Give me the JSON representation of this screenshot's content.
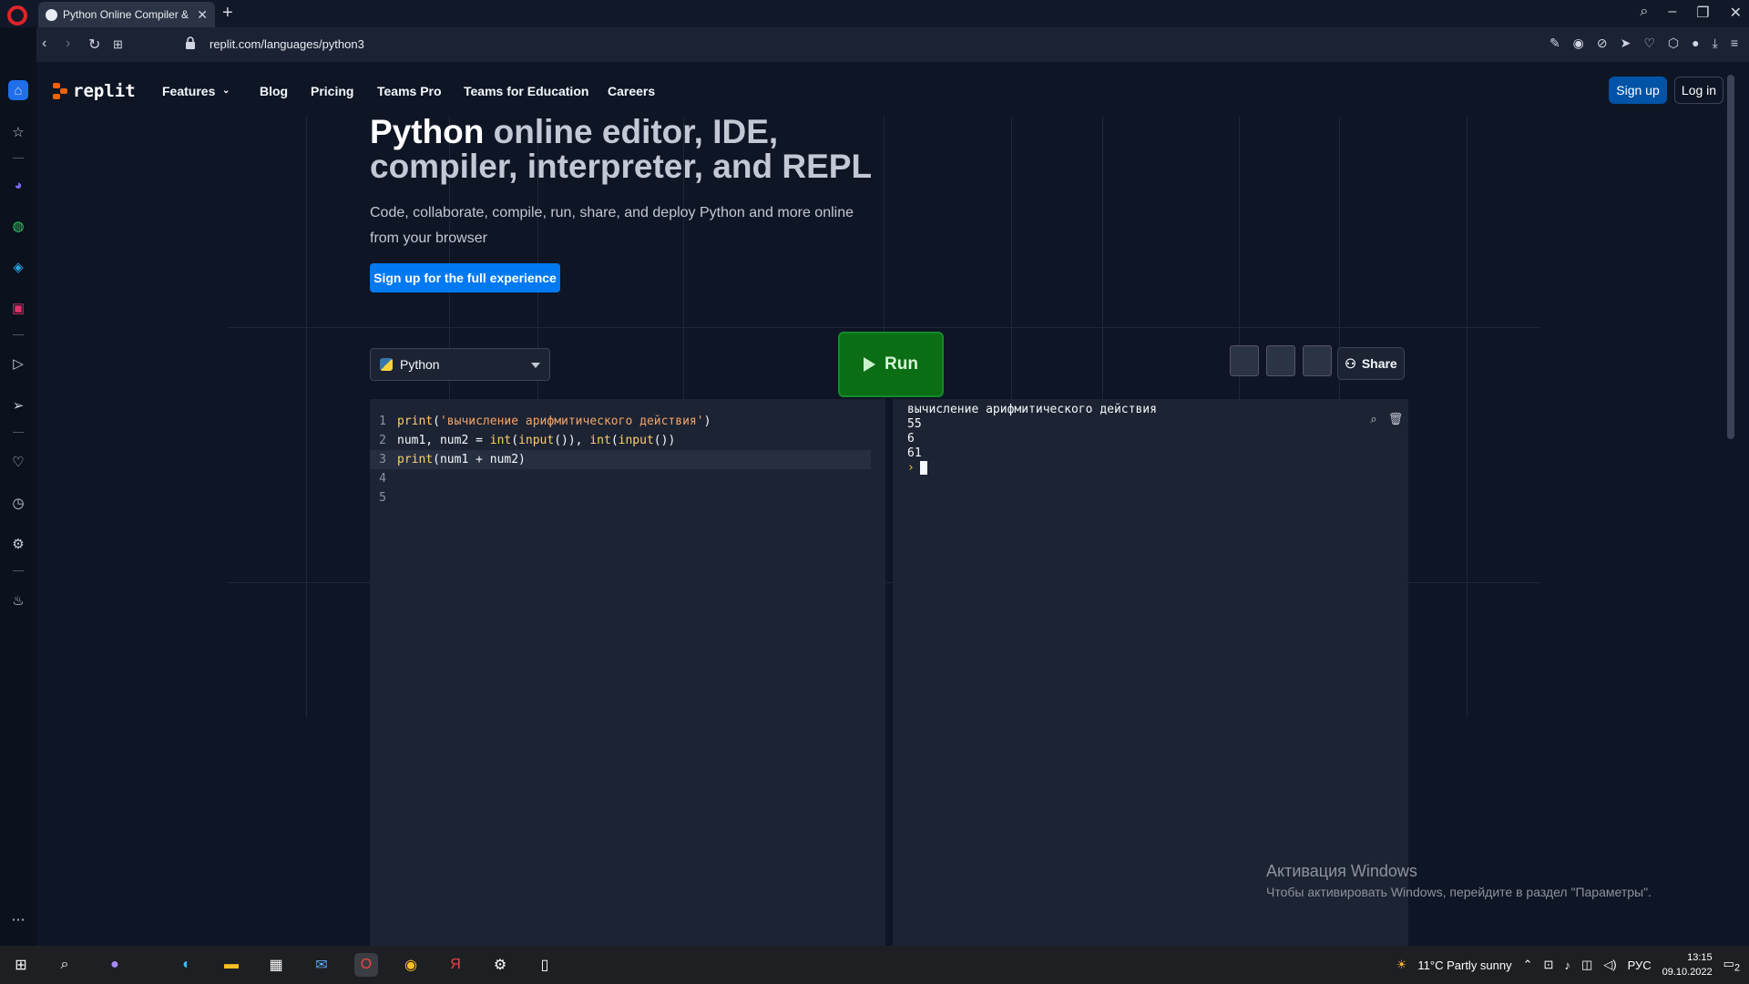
{
  "browser": {
    "tab_title": "Python Online Compiler &",
    "url": "replit.com/languages/python3"
  },
  "site": {
    "logo": "replit",
    "nav": [
      "Features",
      "Blog",
      "Pricing",
      "Teams Pro",
      "Teams for Education",
      "Careers"
    ],
    "signup": "Sign up",
    "login": "Log in"
  },
  "hero": {
    "title_bold": "Python",
    "title_rest": " online editor, IDE, compiler, interpreter, and REPL",
    "subtitle": "Code, collaborate, compile, run, share, and deploy Python and more online from your browser",
    "cta": "Sign up for the full experience"
  },
  "toolbar": {
    "language": "Python",
    "run": "Run",
    "share": "Share"
  },
  "editor": {
    "lines": [
      {
        "n": "1",
        "parts": [
          [
            "fn",
            "print"
          ],
          [
            "",
            "("
          ],
          [
            "str",
            "'вычисление арифмитического действия'"
          ],
          [
            "",
            ")"
          ]
        ]
      },
      {
        "n": "2",
        "parts": [
          [
            "",
            "num1, num2 = "
          ],
          [
            "fn",
            "int"
          ],
          [
            "",
            "("
          ],
          [
            "fn",
            "input"
          ],
          [
            "",
            "()), "
          ],
          [
            "fn",
            "int"
          ],
          [
            "",
            "("
          ],
          [
            "fn",
            "input"
          ],
          [
            "",
            "())"
          ]
        ]
      },
      {
        "n": "3",
        "parts": [
          [
            "fn",
            "print"
          ],
          [
            "",
            "(num1 + num2)"
          ]
        ]
      },
      {
        "n": "4",
        "parts": []
      },
      {
        "n": "5",
        "parts": []
      }
    ]
  },
  "console": {
    "lines": [
      "вычисление арифмитического действия",
      "55",
      "6",
      "61"
    ],
    "prompt": "›"
  },
  "watermark": {
    "line1": "Активация Windows",
    "line2": "Чтобы активировать Windows, перейдите в раздел \"Параметры\"."
  },
  "taskbar": {
    "weather": "11°C  Partly sunny",
    "lang": "РУС",
    "time": "13:15",
    "date": "09.10.2022",
    "notif_count": "2"
  }
}
